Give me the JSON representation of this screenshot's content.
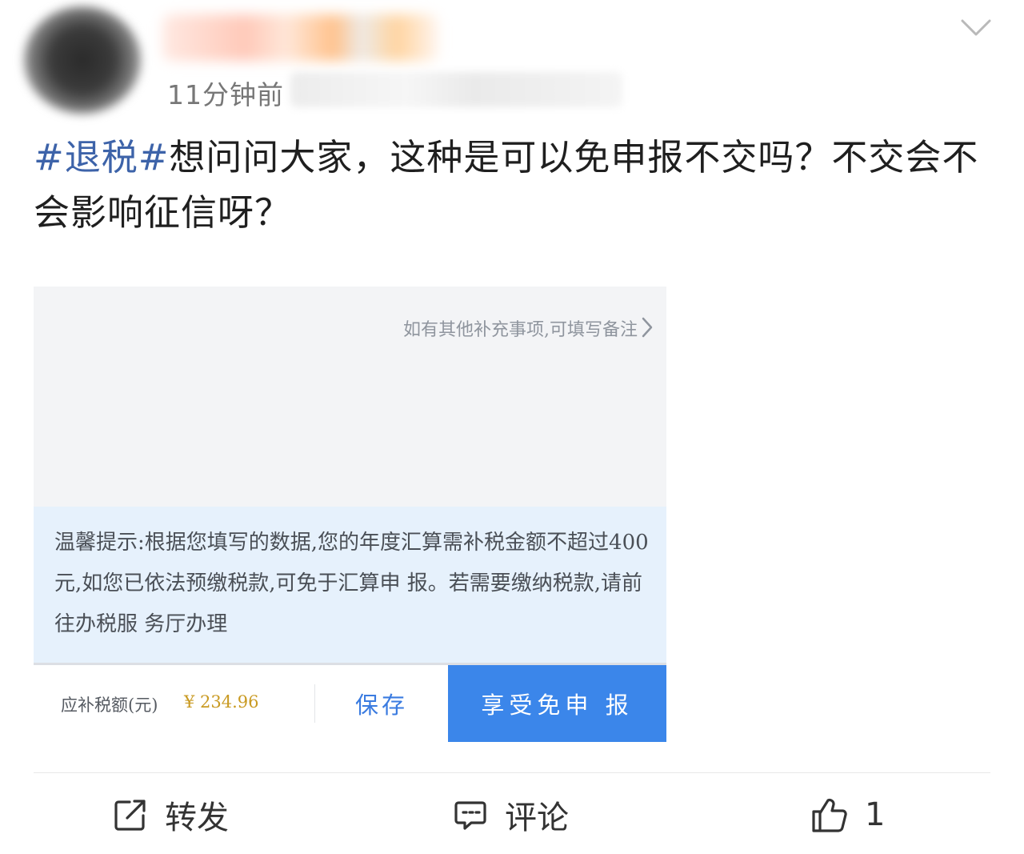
{
  "post": {
    "time": "11分钟前",
    "tag": "#退税#",
    "text": "想问问大家，这种是可以免申报不交吗？不交会不会影响征信呀？"
  },
  "screenshot": {
    "remark": "如有其他补充事项,可填写备注",
    "tip": "温馨提示:根据您填写的数据,您的年度汇算需补税金额不超过400元,如您已依法预缴税款,可免于汇算申 报。若需要缴纳税款,请前往办税服 务厅办理",
    "tax_label": "应补税额(元)",
    "tax_value": "¥ 234.96",
    "save_label": "保存",
    "exempt_label": "享受免申 报"
  },
  "actions": {
    "forward_label": "转发",
    "comment_label": "评论",
    "like_count": "1"
  }
}
